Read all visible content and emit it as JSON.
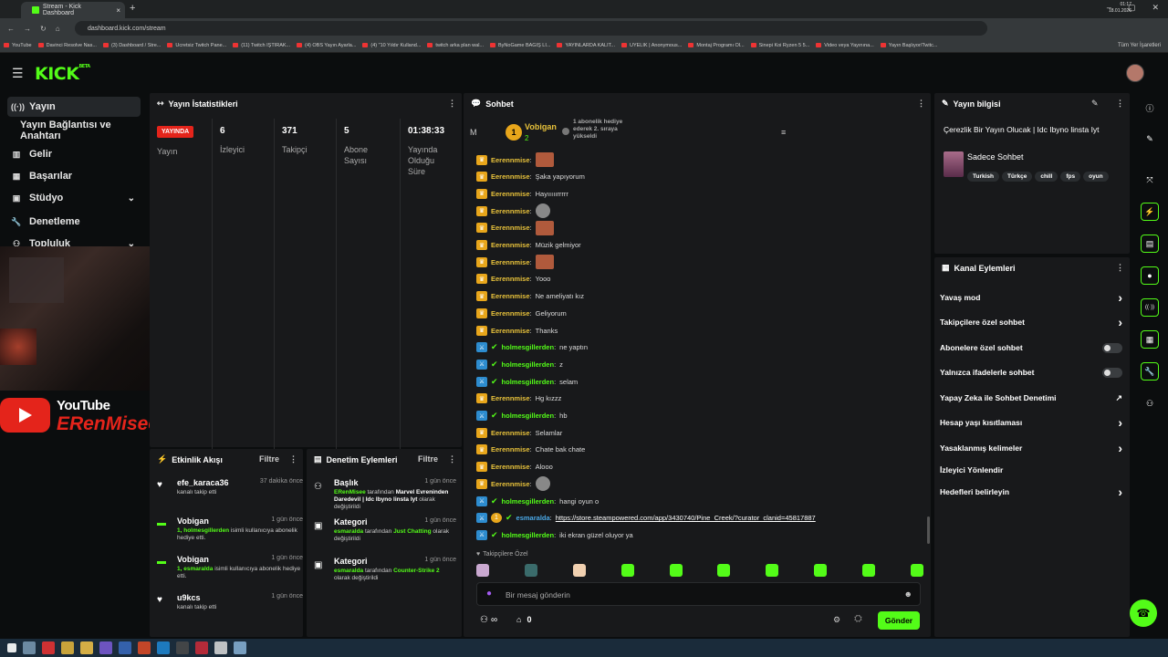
{
  "browser": {
    "tab_title": "Stream - Kick Dashboard",
    "url": "dashboard.kick.com/stream",
    "bookmarks": [
      "YouTube",
      "Davinci Resolve Nas...",
      "(3) Dashboard / Stre...",
      "Ücretsiz Twitch Pane...",
      "(11) Twitch İŞTİRAK...",
      "(4) OBS Yayın Ayarla...",
      "(4) \"10 Yıldır Kulland...",
      "twitch arka plan wal...",
      "ByNoGame BAĞIŞ Lİ...",
      "YAYINLARDA KALIT...",
      "ÜYELİK | Anonymous...",
      "Montaj Programı Ol...",
      "Sinepi Koi Ryzen 5 5...",
      "Video veya Yayınına...",
      "Yayın Başlıyor/Twitc..."
    ],
    "all_bookmarks": "Tüm Yer İşaretleri"
  },
  "header": {
    "logo": "KICK",
    "logo_sup": "BETA"
  },
  "sidebar": {
    "items": [
      {
        "label": "Yayın",
        "icon": "broadcast-icon"
      },
      {
        "label": "Yayın Bağlantısı ve Anahtarı",
        "icon": ""
      },
      {
        "label": "Gelir",
        "icon": "revenue-icon"
      },
      {
        "label": "Başarılar",
        "icon": "achievements-icon"
      },
      {
        "label": "Stüdyo",
        "icon": "studio-icon"
      },
      {
        "label": "Denetleme",
        "icon": "moderation-icon"
      },
      {
        "label": "Topluluk",
        "icon": "community-icon"
      }
    ]
  },
  "overlay": {
    "youtube_text": "YouTube",
    "channel_name": "ERenMisee"
  },
  "stats": {
    "title": "Yayın İstatistikleri",
    "live_badge": "YAYINDA",
    "live_label": "Yayın",
    "viewers": {
      "value": "6",
      "label": "İzleyici"
    },
    "followers": {
      "value": "371",
      "label": "Takipçi"
    },
    "subs": {
      "value": "5",
      "label": "Abone Sayısı"
    },
    "duration": {
      "value": "01:38:33",
      "label": "Yayında Olduğu Süre"
    }
  },
  "activity": {
    "title": "Etkinlik Akışı",
    "filter": "Filtre",
    "items": [
      {
        "name": "efe_karaca36",
        "time": "37 dakika önce",
        "sub": "kanalı takip etti",
        "hl": ""
      },
      {
        "name": "Vobigan",
        "time": "1 gün önce",
        "hl": "1, holmesgillerden",
        "sub": " isimli kullanıcıya abonelik hediye etti."
      },
      {
        "name": "Vobigan",
        "time": "1 gün önce",
        "hl": "1, esmaralda",
        "sub": " isimli kullanıcıya abonelik hediye etti."
      },
      {
        "name": "u9kcs",
        "time": "1 gün önce",
        "sub": "kanalı takip etti",
        "hl": ""
      }
    ]
  },
  "moderation": {
    "title": "Denetim Eylemleri",
    "filter": "Filtre",
    "items": [
      {
        "name": "Başlık",
        "time": "1 gün önce",
        "hl": "ERenMisee",
        "mid": " tarafından ",
        "bold": "Marvel Evreninden Daredevil | Idc Ibyno linsta Iyt",
        "tail": " olarak değiştirildi"
      },
      {
        "name": "Kategori",
        "time": "1 gün önce",
        "hl": "esmaralda",
        "mid": " tarafından ",
        "bold": "Just Chatting",
        "tail": " olarak değiştirildi"
      },
      {
        "name": "Kategori",
        "time": "1 gün önce",
        "hl": "esmaralda",
        "mid": " tarafından ",
        "bold": "Counter-Strike 2",
        "tail": " olarak değiştirildi"
      }
    ]
  },
  "chat": {
    "title": "Sohbet",
    "pinned_initial": "M",
    "gift_user": "Vobigan",
    "gift_count": "2",
    "gift_text": "1 abonelik hediye ederek 2. sıraya yükseldi",
    "messages": [
      {
        "user": "Eerennmise",
        "text": "",
        "emote": "red",
        "badge": "crown",
        "color": "o"
      },
      {
        "user": "Eerennmise",
        "text": "Şaka yapıyorum",
        "emote": "",
        "badge": "crown",
        "color": "o"
      },
      {
        "user": "Eerennmise",
        "text": "Hayııııırrrrr",
        "emote": "",
        "badge": "crown",
        "color": "o"
      },
      {
        "user": "Eerennmise",
        "text": "",
        "emote": "gray",
        "badge": "crown",
        "color": "o"
      },
      {
        "user": "Eerennmise",
        "text": "",
        "emote": "red",
        "badge": "crown",
        "color": "o"
      },
      {
        "user": "Eerennmise",
        "text": "Müzik gelmiyor",
        "emote": "",
        "badge": "crown",
        "color": "o"
      },
      {
        "user": "Eerennmise",
        "text": "",
        "emote": "red",
        "badge": "crown",
        "color": "o"
      },
      {
        "user": "Eerennmise",
        "text": "Yooo",
        "emote": "",
        "badge": "crown",
        "color": "o"
      },
      {
        "user": "Eerennmise",
        "text": "Ne ameliyatı kız",
        "emote": "",
        "badge": "crown",
        "color": "o"
      },
      {
        "user": "Eerennmise",
        "text": "Geliyorum",
        "emote": "",
        "badge": "crown",
        "color": "o"
      },
      {
        "user": "Eerennmise",
        "text": "Thanks",
        "emote": "",
        "badge": "crown",
        "color": "o"
      },
      {
        "user": "holmesgillerden",
        "text": "ne yaptın",
        "emote": "",
        "badge": "mod",
        "color": "g"
      },
      {
        "user": "holmesgillerden",
        "text": "z",
        "emote": "",
        "badge": "mod",
        "color": "g"
      },
      {
        "user": "holmesgillerden",
        "text": "selam",
        "emote": "",
        "badge": "mod",
        "color": "g"
      },
      {
        "user": "Eerennmise",
        "text": "Hg kızzz",
        "emote": "",
        "badge": "crown",
        "color": "o"
      },
      {
        "user": "holmesgillerden",
        "text": "hb",
        "emote": "",
        "badge": "mod",
        "color": "g"
      },
      {
        "user": "Eerennmise",
        "text": "Selamlar",
        "emote": "",
        "badge": "crown",
        "color": "o"
      },
      {
        "user": "Eerennmise",
        "text": "Chate bak chate",
        "emote": "",
        "badge": "crown",
        "color": "o"
      },
      {
        "user": "Eerennmise",
        "text": "Alooo",
        "emote": "",
        "badge": "crown",
        "color": "o"
      },
      {
        "user": "Eerennmise",
        "text": "",
        "emote": "gray",
        "badge": "crown",
        "color": "o"
      },
      {
        "user": "holmesgillerden",
        "text": "hangi oyun o",
        "emote": "",
        "badge": "mod",
        "color": "g"
      },
      {
        "user": "esmaralda",
        "text": "https://store.steampowered.com/app/3430740/Pine_Creek/?curator_clanid=45817887",
        "emote": "",
        "badge": "mod",
        "color": "b"
      },
      {
        "user": "holmesgillerden",
        "text": "iki ekran güzel oluyor ya",
        "emote": "",
        "badge": "mod",
        "color": "g"
      }
    ],
    "followers_only": "Takipçilere Özel",
    "input_placeholder": "Bir mesaj gönderin",
    "infinity": "∞",
    "store_count": "0",
    "send_label": "Gönder"
  },
  "stream_info": {
    "title": "Yayın bilgisi",
    "stream_title": "Çerezlik Bir Yayın Olucak | Idc Ibyno linsta Iyt",
    "category": "Sadece Sohbet",
    "tags": [
      "Turkish",
      "Türkçe",
      "chill",
      "fps",
      "oyun"
    ]
  },
  "channel_actions": {
    "title": "Kanal Eylemleri",
    "items": [
      {
        "label": "Yavaş mod",
        "control": "chevron"
      },
      {
        "label": "Takipçilere özel sohbet",
        "control": "chevron"
      },
      {
        "label": "Abonelere özel sohbet",
        "control": "toggle"
      },
      {
        "label": "Yalnızca ifadelerle sohbet",
        "control": "toggle"
      },
      {
        "label": "Yapay Zeka ile Sohbet Denetimi",
        "control": "external"
      },
      {
        "label": "Hesap yaşı kısıtlaması",
        "control": "chevron"
      },
      {
        "label": "Yasaklanmış kelimeler",
        "control": "chevron"
      },
      {
        "label": "İzleyici Yönlendir",
        "control": "none"
      },
      {
        "label": "Hedefleri belirleyin",
        "control": "chevron"
      }
    ]
  },
  "taskbar": {
    "time": "01:17",
    "date": "18.01.2026"
  },
  "colors": {
    "accent": "#53fc18",
    "live": "#e4241b",
    "panel": "#18191b",
    "bg": "#0b0d0e"
  }
}
